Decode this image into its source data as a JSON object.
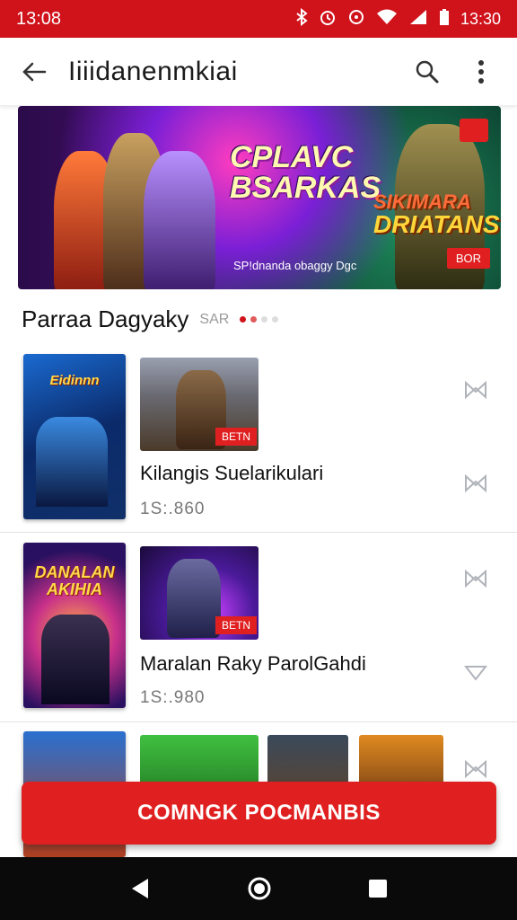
{
  "status_bar": {
    "left_time": "13:08",
    "right_time": "13:30",
    "icons": [
      "bluetooth-icon",
      "alarm-icon",
      "data-saver-icon",
      "wifi-icon",
      "signal-icon",
      "cell-icon",
      "battery-icon"
    ]
  },
  "app_bar": {
    "title": "Iiiidanenmkiai",
    "back_icon": "arrow-back-icon",
    "search_icon": "search-icon",
    "menu_icon": "more-vert-icon"
  },
  "banner": {
    "title_line1": "CPLAVC",
    "title_line2": "BSARKAS",
    "subtitle": "SP!dnanda obaggy Dgc",
    "right_title_line1": "SIKIMARA",
    "right_title_line2": "DRIATANS",
    "tag": "BOR"
  },
  "section": {
    "title": "Parraa Dagyaky",
    "count_label": "SAR",
    "pager_dots": 4,
    "active_dot": 1
  },
  "rows": [
    {
      "poster_label": "Eidinnn",
      "thumb_tag": "BETN",
      "title": "Kilangis Suelarikulari",
      "meta": "1S:.860"
    },
    {
      "poster_label": "DANALAN AKIHIA",
      "thumb_tag": "BETN",
      "title": "Maralan Raky ParolGahdi",
      "meta": "1S:.980"
    }
  ],
  "cta": {
    "label": "COMNGK POCMANBIS"
  },
  "nav_bar": {
    "back_icon": "nav-back-icon",
    "home_icon": "nav-home-icon",
    "recents_icon": "nav-recents-icon"
  },
  "colors": {
    "primary": "#d0121b",
    "accent": "#e02020",
    "nav_bg": "#0a0a0a"
  }
}
